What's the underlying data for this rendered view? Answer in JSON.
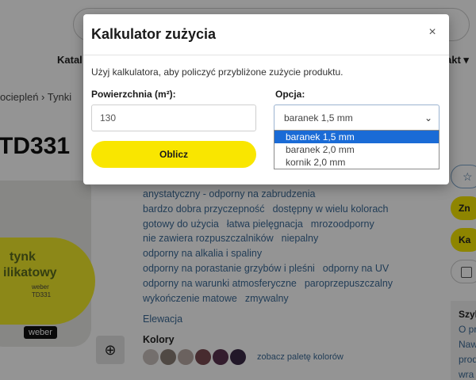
{
  "background": {
    "nav": {
      "left": "Katal",
      "right": "akt"
    },
    "breadcrumb": "ociepleń  ›  Tynki",
    "product_code": "TD331",
    "bucket": {
      "line1": "tynk",
      "line2": "ilikatowy",
      "sub1": "weber",
      "sub2": "TD331",
      "brand": "weber"
    },
    "features": [
      "anystatyczny - odporny na zabrudzenia",
      "bardzo dobra przyczepność",
      "dostępny w wielu kolorach",
      "gotowy do użycia",
      "łatwa pielęgnacja",
      "mrozoodporny",
      "nie zawiera rozpuszczalników",
      "niepalny",
      "odporny na alkalia i spaliny",
      "odporny na porastanie grzybów i pleśni",
      "odporny na UV",
      "odporny na warunki atmosferyczne",
      "paroprzepuszczalny",
      "wykończenie matowe",
      "zmywalny"
    ],
    "elewacja": "Elewacja",
    "kolory_label": "Kolory",
    "swatch_colors": [
      "#c8c0bc",
      "#8b7e76",
      "#b9aaa4",
      "#7a4a52",
      "#5a3350",
      "#3b2a48"
    ],
    "swatch_link": "zobacz paletę kolorów",
    "side": {
      "btn1": "Zn",
      "btn2": "Ka",
      "info_title": "Szyb",
      "info_lines": [
        "O pr",
        "Naw",
        "prod",
        "wra"
      ]
    }
  },
  "modal": {
    "title": "Kalkulator zużycia",
    "close": "×",
    "description": "Użyj kalkulatora, aby policzyć przybliżone zużycie produktu.",
    "area_label": "Powierzchnia (m²):",
    "area_value": "130",
    "option_label": "Opcja:",
    "option_selected": "baranek 1,5 mm",
    "calculate_label": "Oblicz"
  },
  "dropdown": {
    "options": [
      "baranek 1,5 mm",
      "baranek 2,0 mm",
      "kornik 2,0 mm"
    ],
    "selected_index": 0
  },
  "colors": {
    "accent_yellow": "#f9e600",
    "select_blue": "#1a6bd6",
    "link_blue": "#3b6a96"
  }
}
